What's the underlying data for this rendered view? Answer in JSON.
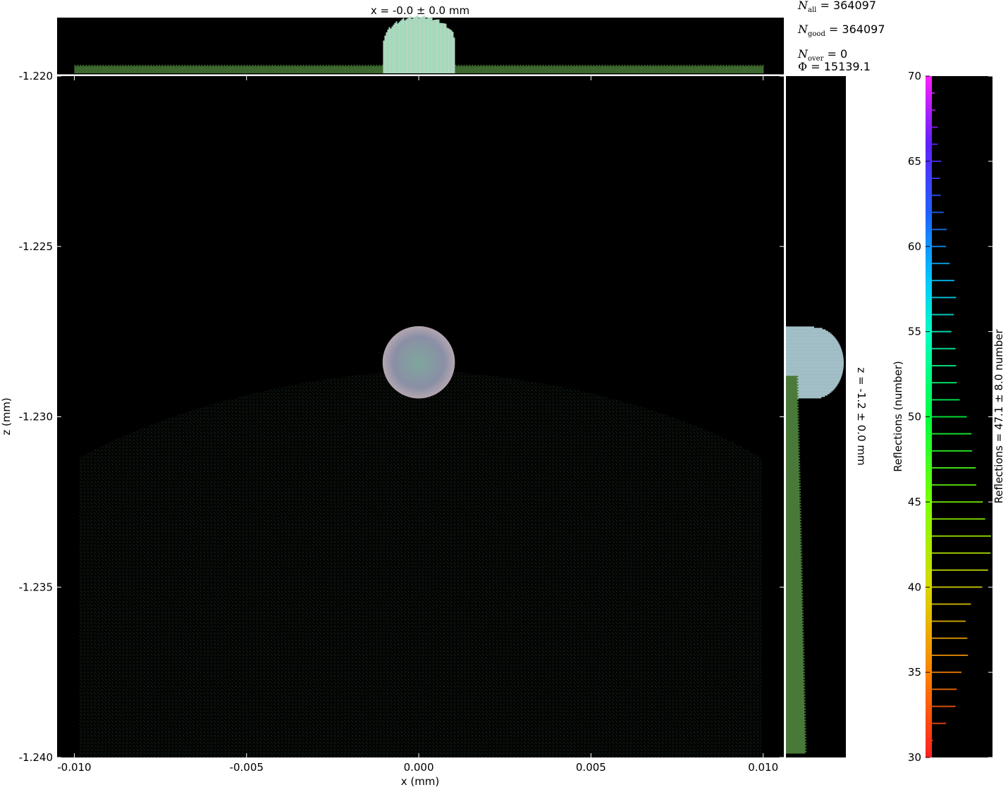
{
  "chart_data": {
    "type": "heatmap",
    "title": "x = -0.0 ± 0.0 mm",
    "xlabel": "x (mm)",
    "ylabel": "z (mm)",
    "side_label": "z = -1.2 ± 0.0 mm",
    "xlim": [
      -0.0105,
      0.0106
    ],
    "ylim": [
      -1.24,
      -1.22
    ],
    "x_ticks": [
      -0.01,
      -0.005,
      0.0,
      0.005,
      0.01
    ],
    "x_tick_labels": [
      "-0.010",
      "-0.005",
      "0.000",
      "0.005",
      "0.010"
    ],
    "y_ticks": [
      -1.22,
      -1.225,
      -1.23,
      -1.235,
      -1.24
    ],
    "y_tick_labels": [
      "-1.220",
      "-1.225",
      "-1.230",
      "-1.235",
      "-1.240"
    ],
    "background_color": "#000000",
    "bright_spot": {
      "x": 0.0,
      "z": -1.2284,
      "radius": 0.00105
    },
    "diffuse_region": {
      "x": [
        -0.01,
        0.01
      ],
      "z_top": -1.2288,
      "z_bottom": -1.24
    },
    "stats": {
      "n_all_label": "N",
      "n_all_sub": "all",
      "n_all": "364097",
      "n_good_label": "N",
      "n_good_sub": "good",
      "n_good": "364097",
      "n_over_label": "N",
      "n_over_sub": "over",
      "n_over": "0",
      "phi_label": "Φ",
      "phi": "15139.1"
    },
    "colorbar": {
      "label": "Reflections (number)",
      "side_label": "Reflections = 47.1 ± 8.0 number",
      "range": [
        30,
        70
      ],
      "ticks": [
        30,
        35,
        40,
        45,
        50,
        55,
        60,
        65,
        70
      ],
      "histogram": {
        "values": [
          31,
          32,
          33,
          34,
          35,
          36,
          37,
          38,
          39,
          40,
          41,
          42,
          43,
          44,
          45,
          46,
          47,
          48,
          49,
          50,
          51,
          52,
          53,
          54,
          55,
          56,
          57,
          58,
          59,
          60,
          61,
          62,
          63,
          64,
          65,
          66,
          67,
          68,
          69
        ],
        "counts": [
          0.02,
          0.24,
          0.4,
          0.42,
          0.5,
          0.61,
          0.6,
          0.57,
          0.66,
          0.85,
          0.95,
          0.99,
          1.0,
          0.9,
          0.86,
          0.75,
          0.74,
          0.68,
          0.67,
          0.59,
          0.47,
          0.42,
          0.41,
          0.4,
          0.33,
          0.37,
          0.41,
          0.38,
          0.3,
          0.24,
          0.25,
          0.2,
          0.15,
          0.14,
          0.16,
          0.1,
          0.1,
          0.06,
          0.05
        ]
      }
    }
  }
}
